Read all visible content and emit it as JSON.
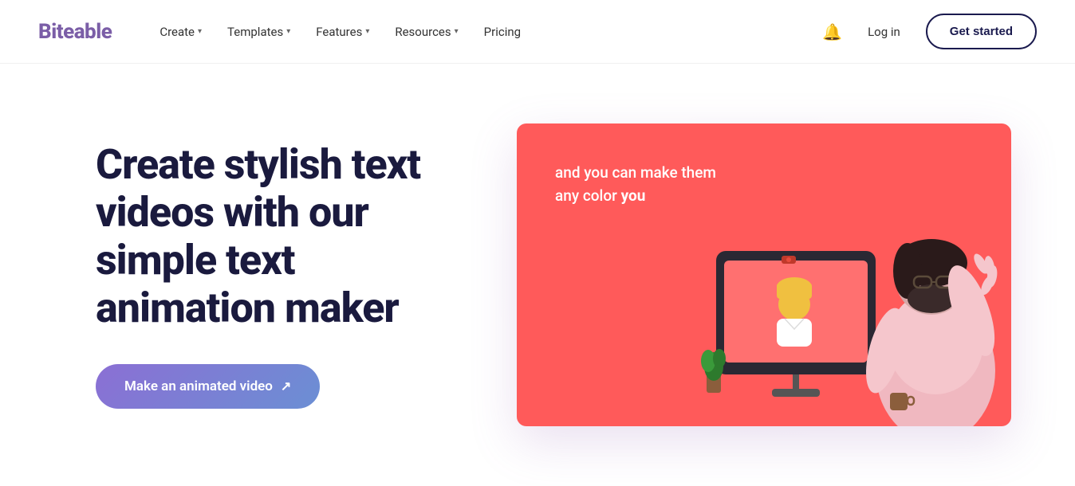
{
  "nav": {
    "logo": "Biteable",
    "items": [
      {
        "label": "Create",
        "hasDropdown": true
      },
      {
        "label": "Templates",
        "hasDropdown": true
      },
      {
        "label": "Features",
        "hasDropdown": true
      },
      {
        "label": "Resources",
        "hasDropdown": true
      },
      {
        "label": "Pricing",
        "hasDropdown": false
      }
    ],
    "login_label": "Log in",
    "get_started_label": "Get started"
  },
  "hero": {
    "heading": "Create stylish text videos with our simple text animation maker",
    "cta_label": "Make an animated video",
    "cta_arrow": "↗"
  },
  "video_card": {
    "line1": "and you can make them",
    "line2_prefix": "any color ",
    "line2_bold": "you"
  }
}
